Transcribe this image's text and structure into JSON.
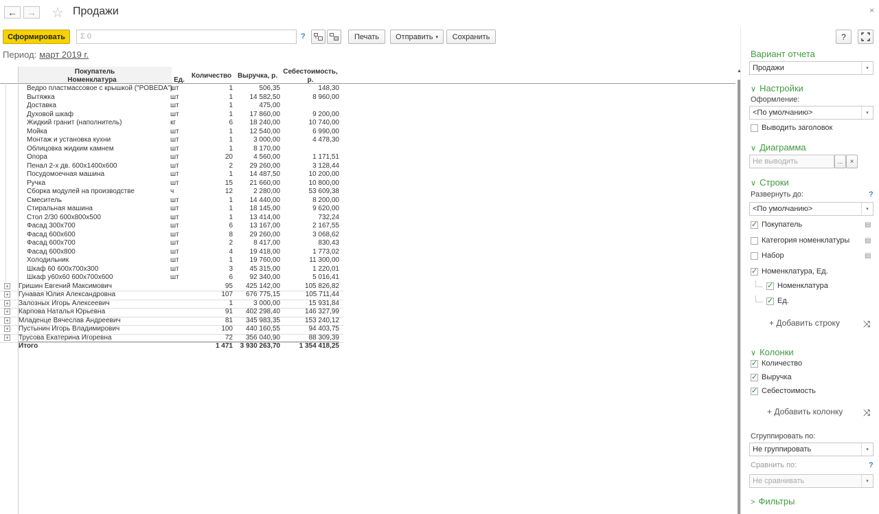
{
  "window": {
    "title": "Продажи",
    "close_glyph": "×",
    "back_glyph": "←",
    "forward_glyph": "→",
    "star_glyph": "☆"
  },
  "toolbar": {
    "generate_label": "Сформировать",
    "sum_placeholder": "Σ 0",
    "help_glyph": "?",
    "print_label": "Печать",
    "send_label": "Отправить",
    "save_label": "Сохранить",
    "help_button": "?"
  },
  "period": {
    "label": "Период:",
    "value": "март 2019 г."
  },
  "report": {
    "headers": {
      "buyer": "Покупатель",
      "item": "Номенклатура",
      "unit": "Ед.",
      "qty": "Количество",
      "revenue": "Выручка, р.",
      "cost_line1": "Себестоимость,",
      "cost_line2": "р."
    },
    "detail_rows": [
      {
        "name": "Ведро пластмассовое с крышкой (\"POBEDA\")",
        "unit": "шт",
        "qty": "1",
        "revenue": "506,35",
        "cost": "148,30"
      },
      {
        "name": "Вытяжка",
        "unit": "шт",
        "qty": "1",
        "revenue": "14 582,50",
        "cost": "8 960,00"
      },
      {
        "name": "Доставка",
        "unit": "шт",
        "qty": "1",
        "revenue": "475,00",
        "cost": ""
      },
      {
        "name": "Духовой шкаф",
        "unit": "шт",
        "qty": "1",
        "revenue": "17 860,00",
        "cost": "9 200,00"
      },
      {
        "name": "Жидкий гранит (наполнитель)",
        "unit": "кг",
        "qty": "6",
        "revenue": "18 240,00",
        "cost": "10 740,00"
      },
      {
        "name": "Мойка",
        "unit": "шт",
        "qty": "1",
        "revenue": "12 540,00",
        "cost": "6 990,00"
      },
      {
        "name": "Монтаж и установка кухни",
        "unit": "шт",
        "qty": "1",
        "revenue": "3 000,00",
        "cost": "4 478,30"
      },
      {
        "name": "Облицовка жидким камнем",
        "unit": "шт",
        "qty": "1",
        "revenue": "8 170,00",
        "cost": ""
      },
      {
        "name": "Опора",
        "unit": "шт",
        "qty": "20",
        "revenue": "4 560,00",
        "cost": "1 171,51"
      },
      {
        "name": "Пенал 2-х дв. 600х1400х600",
        "unit": "шт",
        "qty": "2",
        "revenue": "29 260,00",
        "cost": "3 128,44"
      },
      {
        "name": "Посудомоечная машина",
        "unit": "шт",
        "qty": "1",
        "revenue": "14 487,50",
        "cost": "10 200,00"
      },
      {
        "name": "Ручка",
        "unit": "шт",
        "qty": "15",
        "revenue": "21 660,00",
        "cost": "10 800,00"
      },
      {
        "name": "Сборка модулей на производстве",
        "unit": "ч",
        "qty": "12",
        "revenue": "2 280,00",
        "cost": "53 609,38"
      },
      {
        "name": "Смеситель",
        "unit": "шт",
        "qty": "1",
        "revenue": "14 440,00",
        "cost": "8 200,00"
      },
      {
        "name": "Стиральная машина",
        "unit": "шт",
        "qty": "1",
        "revenue": "18 145,00",
        "cost": "9 620,00"
      },
      {
        "name": "Стол 2/30 600х800х500",
        "unit": "шт",
        "qty": "1",
        "revenue": "13 414,00",
        "cost": "732,24"
      },
      {
        "name": "Фасад 300х700",
        "unit": "шт",
        "qty": "6",
        "revenue": "13 167,00",
        "cost": "2 167,55"
      },
      {
        "name": "Фасад 600х600",
        "unit": "шт",
        "qty": "8",
        "revenue": "29 260,00",
        "cost": "3 068,62"
      },
      {
        "name": "Фасад 600х700",
        "unit": "шт",
        "qty": "2",
        "revenue": "8 417,00",
        "cost": "830,43"
      },
      {
        "name": "Фасад 600х800",
        "unit": "шт",
        "qty": "4",
        "revenue": "19 418,00",
        "cost": "1 773,02"
      },
      {
        "name": "Холодильник",
        "unit": "шт",
        "qty": "1",
        "revenue": "19 760,00",
        "cost": "11 300,00"
      },
      {
        "name": "Шкаф 60 600х700х300",
        "unit": "шт",
        "qty": "3",
        "revenue": "45 315,00",
        "cost": "1 220,01"
      },
      {
        "name": "Шкаф у60х60 600х700х600",
        "unit": "шт",
        "qty": "6",
        "revenue": "92 340,00",
        "cost": "5 016,41"
      }
    ],
    "group_rows": [
      {
        "name": "Гришин Евгений Максимович",
        "qty": "95",
        "revenue": "425 142,00",
        "cost": "105 826,82"
      },
      {
        "name": "Гунавая Юлия Александровна",
        "qty": "107",
        "revenue": "676 775,15",
        "cost": "105 711,44"
      },
      {
        "name": "Залозных Игорь Алексеевич",
        "qty": "1",
        "revenue": "3 000,00",
        "cost": "15 931,84"
      },
      {
        "name": "Карпова Наталья Юрьевна",
        "qty": "91",
        "revenue": "402 298,40",
        "cost": "146 327,99"
      },
      {
        "name": "Младенце Вячеслав Андреевич",
        "qty": "81",
        "revenue": "345 983,35",
        "cost": "153 240,12"
      },
      {
        "name": "Пустынин Игорь Владимирович",
        "qty": "100",
        "revenue": "440 160,55",
        "cost": "94 403,75"
      },
      {
        "name": "Трусова Екатерина Игоревна",
        "qty": "72",
        "revenue": "356 040,90",
        "cost": "88 309,39"
      }
    ],
    "total": {
      "label": "Итого",
      "qty": "1 471",
      "revenue": "3 930 263,70",
      "cost": "1 354 418,25"
    },
    "plus_glyph": "+"
  },
  "panel": {
    "variant_title": "Вариант отчета",
    "variant_value": "Продажи",
    "settings_title": "Настройки",
    "design_label": "Оформление:",
    "design_value": "<По умолчанию>",
    "show_header_label": "Выводить заголовок",
    "chart_title": "Диаграмма",
    "chart_placeholder": "Не выводить",
    "chart_pick_glyph": "...",
    "chart_clear_glyph": "×",
    "rows_title": "Строки",
    "expand_label": "Развернуть до:",
    "expand_value": "<По умолчанию>",
    "row_fields": [
      {
        "label": "Покупатель",
        "checked": true
      },
      {
        "label": "Категория номенклатуры",
        "checked": false
      },
      {
        "label": "Набор",
        "checked": false
      },
      {
        "label": "Номенклатура, Ед.",
        "checked": true
      }
    ],
    "row_subfields": [
      {
        "label": "Номенклатура",
        "checked": true
      },
      {
        "label": "Ед.",
        "checked": true
      }
    ],
    "add_row_label": "+ Добавить строку",
    "columns_title": "Колонки",
    "column_fields": [
      {
        "label": "Количество",
        "checked": true
      },
      {
        "label": "Выручка",
        "checked": true
      },
      {
        "label": "Себестоимость",
        "checked": true
      }
    ],
    "add_column_label": "+ Добавить колонку",
    "group_by_label": "Сгруппировать по:",
    "group_by_value": "Не группировать",
    "compare_label": "Сравнить по:",
    "compare_value": "Не сравнивать",
    "filters_title": "Фильтры",
    "help_glyph": "?",
    "check_glyph": "✓",
    "dropdown_glyph": "▾",
    "chevron_open": "∨",
    "chevron_closed": ">",
    "shuffle_glyph": "⤨",
    "group_icon_glyph": "▤"
  }
}
